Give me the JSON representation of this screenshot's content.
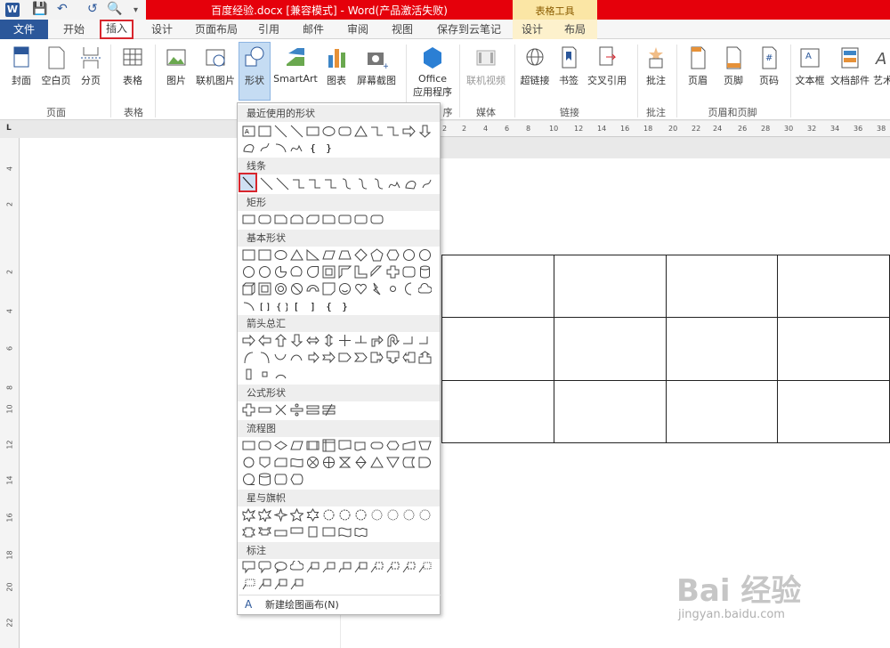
{
  "window": {
    "title": "百度经验.docx [兼容模式] - Word(产品激活失败)",
    "contextual_tab_group": "表格工具"
  },
  "tabs": [
    "文件",
    "开始",
    "插入",
    "设计",
    "页面布局",
    "引用",
    "邮件",
    "审阅",
    "视图",
    "保存到云笔记",
    "设计",
    "布局"
  ],
  "active_tab": "插入",
  "ribbon": {
    "buttons": [
      {
        "label": "封面",
        "icon": "cover-page-icon"
      },
      {
        "label": "空白页",
        "icon": "blank-page-icon"
      },
      {
        "label": "分页",
        "icon": "page-break-icon"
      },
      {
        "label": "表格",
        "icon": "table-icon"
      },
      {
        "label": "图片",
        "icon": "picture-icon"
      },
      {
        "label": "联机图片",
        "icon": "online-picture-icon"
      },
      {
        "label": "形状",
        "icon": "shapes-icon"
      },
      {
        "label": "SmartArt",
        "icon": "smartart-icon"
      },
      {
        "label": "图表",
        "icon": "chart-icon"
      },
      {
        "label": "屏幕截图",
        "icon": "screenshot-icon"
      },
      {
        "label": "Office",
        "icon": "office-icon"
      },
      {
        "label": "应用程序",
        "icon": ""
      },
      {
        "label": "联机视频",
        "icon": "online-video-icon"
      },
      {
        "label": "超链接",
        "icon": "hyperlink-icon"
      },
      {
        "label": "书签",
        "icon": "bookmark-icon"
      },
      {
        "label": "交叉引用",
        "icon": "cross-reference-icon"
      },
      {
        "label": "批注",
        "icon": "comment-icon"
      },
      {
        "label": "页眉",
        "icon": "header-icon"
      },
      {
        "label": "页脚",
        "icon": "footer-icon"
      },
      {
        "label": "页码",
        "icon": "page-number-icon"
      },
      {
        "label": "文本框",
        "icon": "textbox-icon"
      },
      {
        "label": "文档部件",
        "icon": "quick-parts-icon"
      },
      {
        "label": "艺术",
        "icon": "wordart-icon"
      }
    ],
    "groups": [
      "页面",
      "表格",
      "序",
      "媒体",
      "链接",
      "批注",
      "页眉和页脚"
    ]
  },
  "shapes_menu": {
    "sections": [
      "最近使用的形状",
      "线条",
      "矩形",
      "基本形状",
      "箭头总汇",
      "公式形状",
      "流程图",
      "星与旗帜",
      "标注"
    ],
    "new_canvas": "新建绘图画布(N)"
  },
  "rulers": {
    "top": [
      "2",
      "2",
      "4",
      "6",
      "8",
      "10",
      "12",
      "14",
      "16",
      "18",
      "20",
      "22",
      "24",
      "26",
      "28",
      "30",
      "32",
      "34",
      "36",
      "38"
    ],
    "left": [
      "4",
      "2",
      "2",
      "4",
      "6",
      "8",
      "10",
      "12",
      "14",
      "16",
      "18",
      "20",
      "22"
    ]
  },
  "watermark": {
    "brand": "Bai 经验",
    "url": "jingyan.baidu.com"
  },
  "colors": {
    "word_blue": "#2b579a",
    "title_red": "#e5000b",
    "highlight": "#d8262d"
  }
}
